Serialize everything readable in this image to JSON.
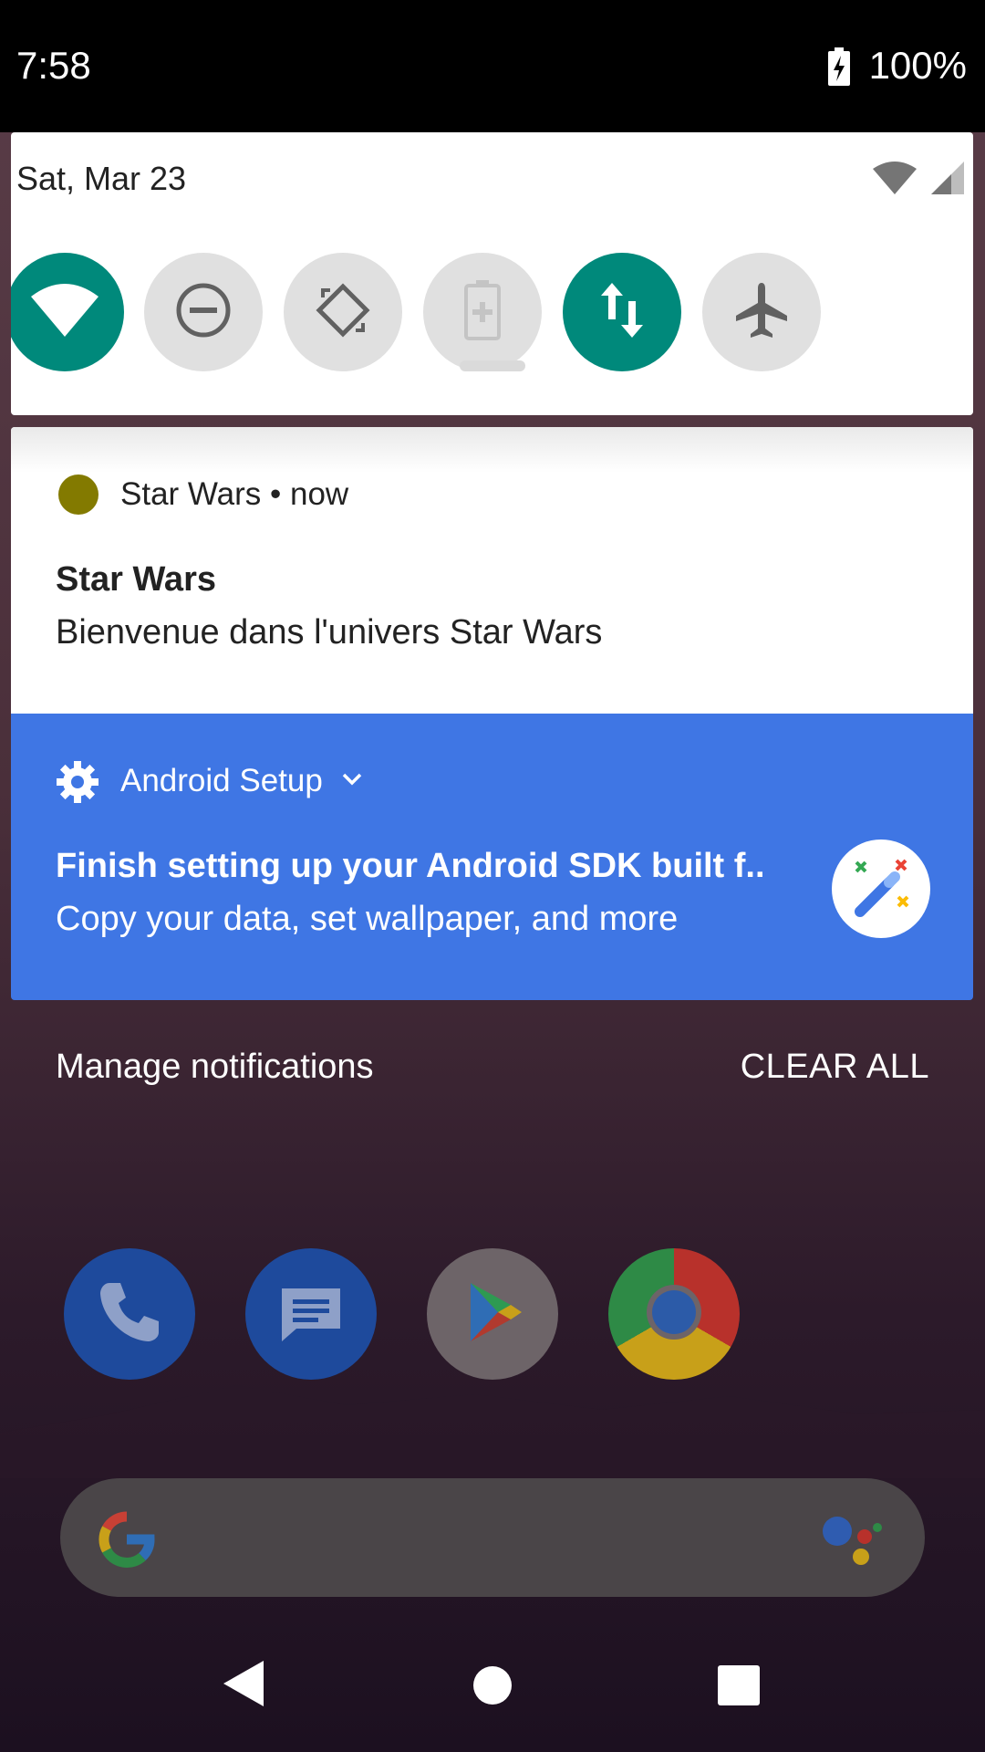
{
  "status_bar": {
    "time": "7:58",
    "battery": "100%"
  },
  "quick_settings": {
    "date": "Sat, Mar 23",
    "tiles": [
      {
        "name": "wifi",
        "state": "on"
      },
      {
        "name": "do-not-disturb",
        "state": "off"
      },
      {
        "name": "auto-rotate",
        "state": "off"
      },
      {
        "name": "battery-saver",
        "state": "off"
      },
      {
        "name": "mobile-data",
        "state": "on"
      },
      {
        "name": "airplane-mode",
        "state": "off"
      }
    ]
  },
  "notifications": [
    {
      "app": "Star Wars",
      "time": "now",
      "title": "Star Wars",
      "text": "Bienvenue dans l'univers Star Wars",
      "icon_color": "#837a00"
    },
    {
      "app": "Android Setup",
      "title": "Finish setting up your Android SDK built f..",
      "text": "Copy your data, set wallpaper, and more",
      "background": "#3f76e4"
    }
  ],
  "footer": {
    "manage": "Manage notifications",
    "clear": "CLEAR ALL"
  },
  "dock": [
    "phone-icon",
    "messages-icon",
    "play-store-icon",
    "chrome-icon"
  ],
  "colors": {
    "accent": "#00897b",
    "setup_blue": "#3f76e4"
  }
}
